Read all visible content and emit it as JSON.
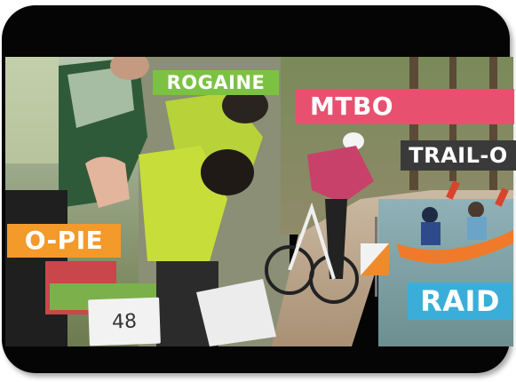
{
  "labels": {
    "rogaine": "ROGAINE",
    "mtbo": "MTBO",
    "trail_o": "TRAIL-O",
    "o_pie": "O-PIE",
    "raid": "RAID"
  },
  "bib_number": "48",
  "colors": {
    "rogaine": "#7cc242",
    "mtbo": "#e8506f",
    "trail_o": "#3a3a3a",
    "o_pie": "#f39a2b",
    "raid": "#3aaed8",
    "frame": "#050505"
  },
  "icons": {
    "control_flag": "orienteering-control-flag-icon"
  }
}
